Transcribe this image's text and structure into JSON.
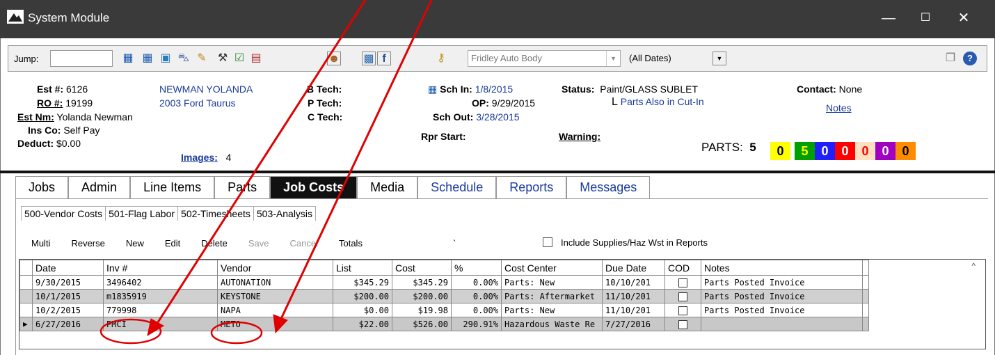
{
  "window": {
    "title": "System Module",
    "controls": {
      "min": "—",
      "max": "☐",
      "close": "✕"
    }
  },
  "toolbar": {
    "jump_label": "Jump:",
    "jump_value": "",
    "shop_name": "Fridley Auto Body",
    "date_filter": "(All Dates)"
  },
  "info": {
    "est_label": "Est #:",
    "est_value": "6126",
    "ro_label": "RO #:",
    "ro_value": "19199",
    "estnm_label": "Est Nm:",
    "estnm_value": "Yolanda Newman",
    "insco_label": "Ins Co:",
    "insco_value": "Self Pay",
    "deduct_label": "Deduct:",
    "deduct_value": "$0.00",
    "customer_name": "NEWMAN YOLANDA",
    "vehicle": "2003 Ford Taurus",
    "images_label": "Images:",
    "images_count": "4",
    "btech_label": "B Tech:",
    "ptech_label": "P Tech:",
    "ctech_label": "C Tech:",
    "schin_label": "Sch In:",
    "schin_value": "1/8/2015",
    "op_label": "OP:",
    "op_value": "9/29/2015",
    "schout_label": "Sch Out:",
    "schout_value": "3/28/2015",
    "rprstart_label": "Rpr Start:",
    "status_label": "Status:",
    "status_value": "Paint/GLASS SUBLET",
    "status_sub": "Parts Also in Cut-In",
    "warning_label": "Warning:",
    "contact_label": "Contact:",
    "contact_value": "None",
    "notes_link": "Notes",
    "parts_label": "PARTS:",
    "parts_total": "5",
    "parts_boxes": [
      {
        "value": "0",
        "bg": "#ffff00",
        "fg": "#000000"
      },
      {
        "value": "5",
        "bg": "#00a000",
        "fg": "#ffff00"
      },
      {
        "value": "0",
        "bg": "#2020ff",
        "fg": "#ffffff"
      },
      {
        "value": "0",
        "bg": "#ff0000",
        "fg": "#ffffff"
      },
      {
        "value": "0",
        "bg": "#ffe0c0",
        "fg": "#ff0000"
      },
      {
        "value": "0",
        "bg": "#a000c0",
        "fg": "#ffffff"
      },
      {
        "value": "0",
        "bg": "#ff8c00",
        "fg": "#000000"
      }
    ]
  },
  "tabs": [
    {
      "label": "Jobs"
    },
    {
      "label": "Admin"
    },
    {
      "label": "Line Items"
    },
    {
      "label": "Parts"
    },
    {
      "label": "Job Costs"
    },
    {
      "label": "Media"
    },
    {
      "label": "Schedule"
    },
    {
      "label": "Reports"
    },
    {
      "label": "Messages"
    }
  ],
  "subtabs": [
    {
      "label": "500-Vendor Costs"
    },
    {
      "label": "501-Flag Labor"
    },
    {
      "label": "502-Timesheets"
    },
    {
      "label": "503-Analysis"
    }
  ],
  "actions": {
    "multi": "Multi",
    "reverse": "Reverse",
    "new": "New",
    "edit": "Edit",
    "delete": "Delete",
    "save": "Save",
    "cancel": "Cancel",
    "totals": "Totals",
    "tick": "`",
    "include_label": "Include Supplies/Haz Wst in Reports"
  },
  "grid": {
    "headers": [
      "Date",
      "Inv #",
      "Vendor",
      "List",
      "Cost",
      "%",
      "Cost Center",
      "Due Date",
      "COD",
      "Notes"
    ],
    "rows": [
      [
        "9/30/2015",
        "3496402",
        "AUTONATION",
        "$345.29",
        "$345.29",
        "0.00%",
        "Parts: New",
        "10/10/201",
        "",
        "Parts Posted Invoice"
      ],
      [
        "10/1/2015",
        "m1835919",
        "KEYSTONE",
        "$200.00",
        "$200.00",
        "0.00%",
        "Parts: Aftermarket",
        "11/10/201",
        "",
        "Parts Posted Invoice"
      ],
      [
        "10/2/2015",
        "779998",
        "NAPA",
        "$0.00",
        "$19.98",
        "0.00%",
        "Parts: New",
        "11/10/201",
        "",
        "Parts Posted Invoice"
      ],
      [
        "6/27/2016",
        "PMCI",
        "METO",
        "$22.00",
        "$526.00",
        "290.91%",
        "Hazardous Waste Re",
        "7/27/2016",
        "",
        ""
      ]
    ]
  },
  "annotation_color": "#e00000"
}
